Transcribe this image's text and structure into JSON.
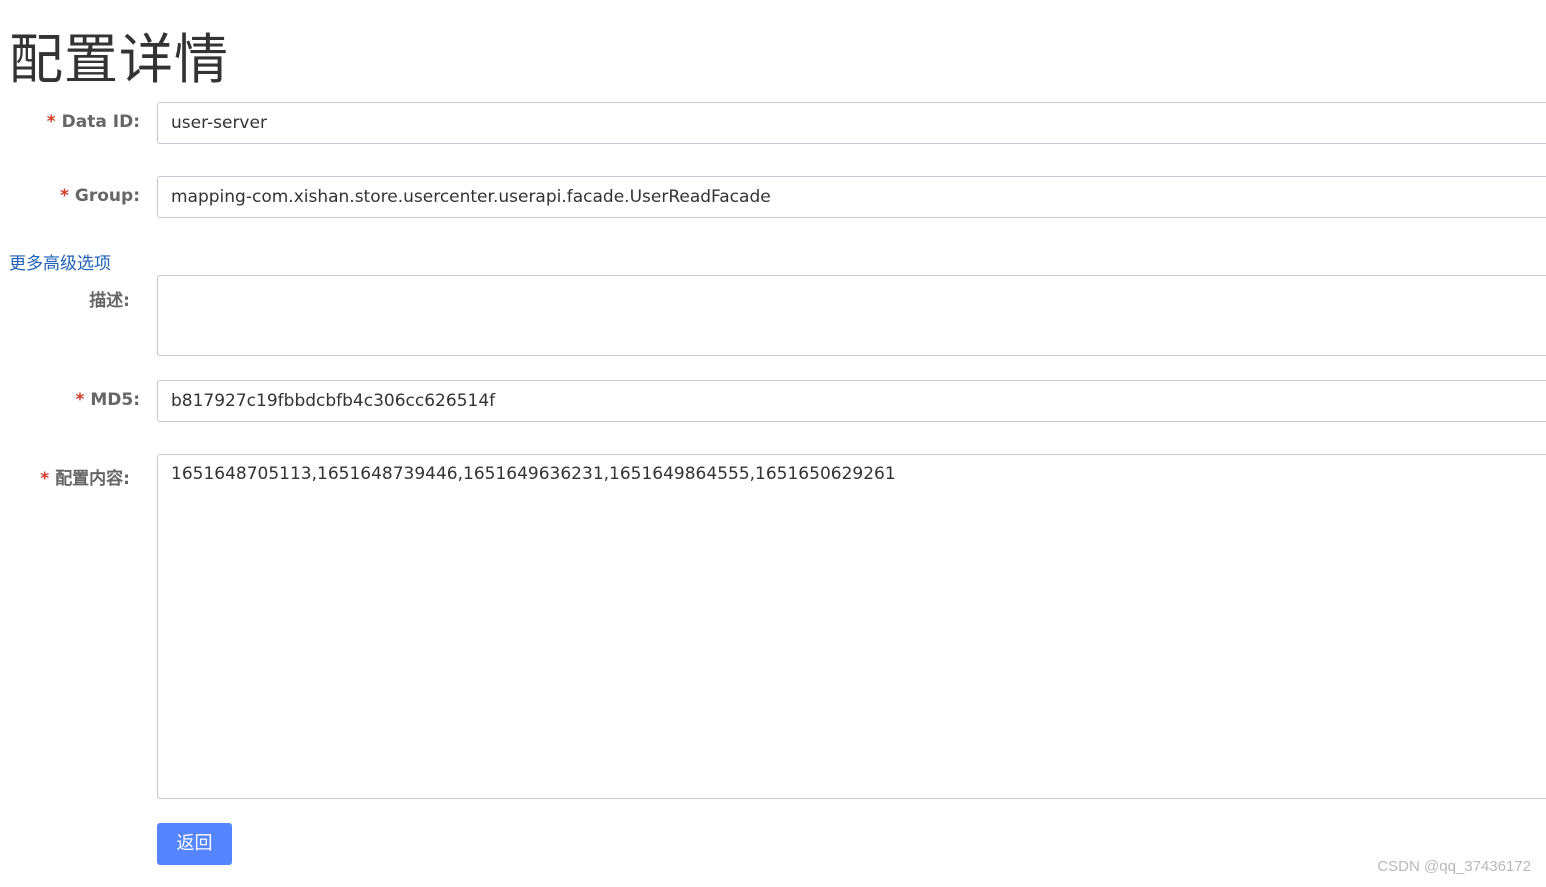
{
  "page": {
    "title": "配置详情"
  },
  "form": {
    "data_id": {
      "required_mark": "*",
      "label": "Data ID:",
      "value": "user-server"
    },
    "group": {
      "required_mark": "*",
      "label": "Group:",
      "value": "mapping-com.xishan.store.usercenter.userapi.facade.UserReadFacade"
    },
    "advanced_options_link": "更多高级选项",
    "description": {
      "label": "描述:",
      "value": ""
    },
    "md5": {
      "required_mark": "*",
      "label": "MD5:",
      "value": "b817927c19fbbdcbfb4c306cc626514f"
    },
    "content": {
      "required_mark": "*",
      "label": "配置内容:",
      "value": "1651648705113,1651648739446,1651649636231,1651649864555,1651650629261"
    }
  },
  "actions": {
    "back_label": "返回"
  },
  "watermark": "CSDN @qq_37436172",
  "colors": {
    "required": "#d23c26",
    "link": "#1f61b8",
    "primary_button": "#5584ff",
    "border": "#c4c6cf",
    "label": "#666666"
  }
}
